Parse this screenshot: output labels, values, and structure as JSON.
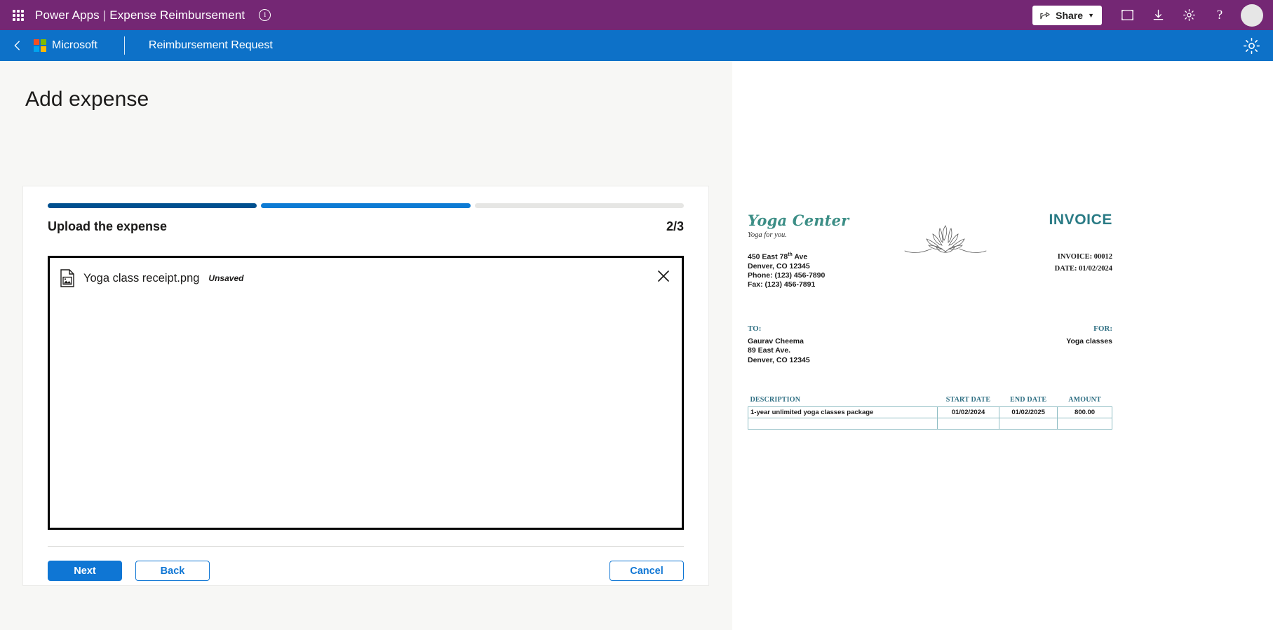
{
  "appbar": {
    "waffle_icon": "app-launcher-icon",
    "product": "Power Apps",
    "separator": "|",
    "app_name": "Expense Reimbursement",
    "info_icon": "i",
    "share_label": "Share",
    "share_chevron": "⌄",
    "icons": [
      "fit-screen-icon",
      "download-icon",
      "settings-gear-icon",
      "help-question-icon"
    ],
    "avatar": "user-avatar",
    "background_color": "#742774"
  },
  "subbar": {
    "back_icon": "back-chevron-icon",
    "brand": "Microsoft",
    "title": "Reimbursement Request",
    "gear_icon": "settings-gear-icon",
    "background_color": "#0d71c8",
    "logo_colors": {
      "top_left": "#f25022",
      "top_right": "#7fba00",
      "bottom_left": "#00a4ef",
      "bottom_right": "#ffb900"
    }
  },
  "main": {
    "page_title": "Add expense",
    "progress": {
      "segments": [
        {
          "state": "completed",
          "color": "#00508f"
        },
        {
          "state": "current",
          "color": "#0d7bd4"
        },
        {
          "state": "upcoming",
          "color": "#e6e6e4"
        }
      ]
    },
    "step_title": "Upload the expense",
    "step_counter": "2/3",
    "file": {
      "doc_icon": "image-document-icon",
      "name": "Yoga class receipt.png",
      "status": "Unsaved",
      "close_icon": "close-x-icon"
    },
    "buttons": {
      "next": "Next",
      "back": "Back",
      "cancel": "Cancel",
      "accent_color": "#0f76d4"
    }
  },
  "invoice": {
    "logo_text": "Yoga Center",
    "tagline": "Yoga for you.",
    "address_line1_pre": "450 East 78",
    "address_line1_sup": "th",
    "address_line1_post": " Ave",
    "address_line2": "Denver, CO 12345",
    "phone": "Phone: (123) 456-7890",
    "fax": "Fax: (123) 456-7891",
    "lotus_icon": "lotus-flower-illustration",
    "heading": "INVOICE",
    "number_label": "INVOICE: 00012",
    "date_label": "DATE: 01/02/2024",
    "to_label": "TO:",
    "to_name": "Gaurav Cheema",
    "to_street": "89 East Ave.",
    "to_city": "Denver, CO 12345",
    "for_label": "FOR:",
    "for_value": "Yoga classes",
    "table": {
      "headers": [
        "DESCRIPTION",
        "START DATE",
        "END DATE",
        "AMOUNT"
      ],
      "rows": [
        [
          "1-year unlimited yoga classes package",
          "01/02/2024",
          "01/02/2025",
          "800.00"
        ],
        [
          "",
          "",
          "",
          ""
        ]
      ]
    },
    "accent_color": "#2f6f83",
    "logo_color": "#3c8e86"
  }
}
